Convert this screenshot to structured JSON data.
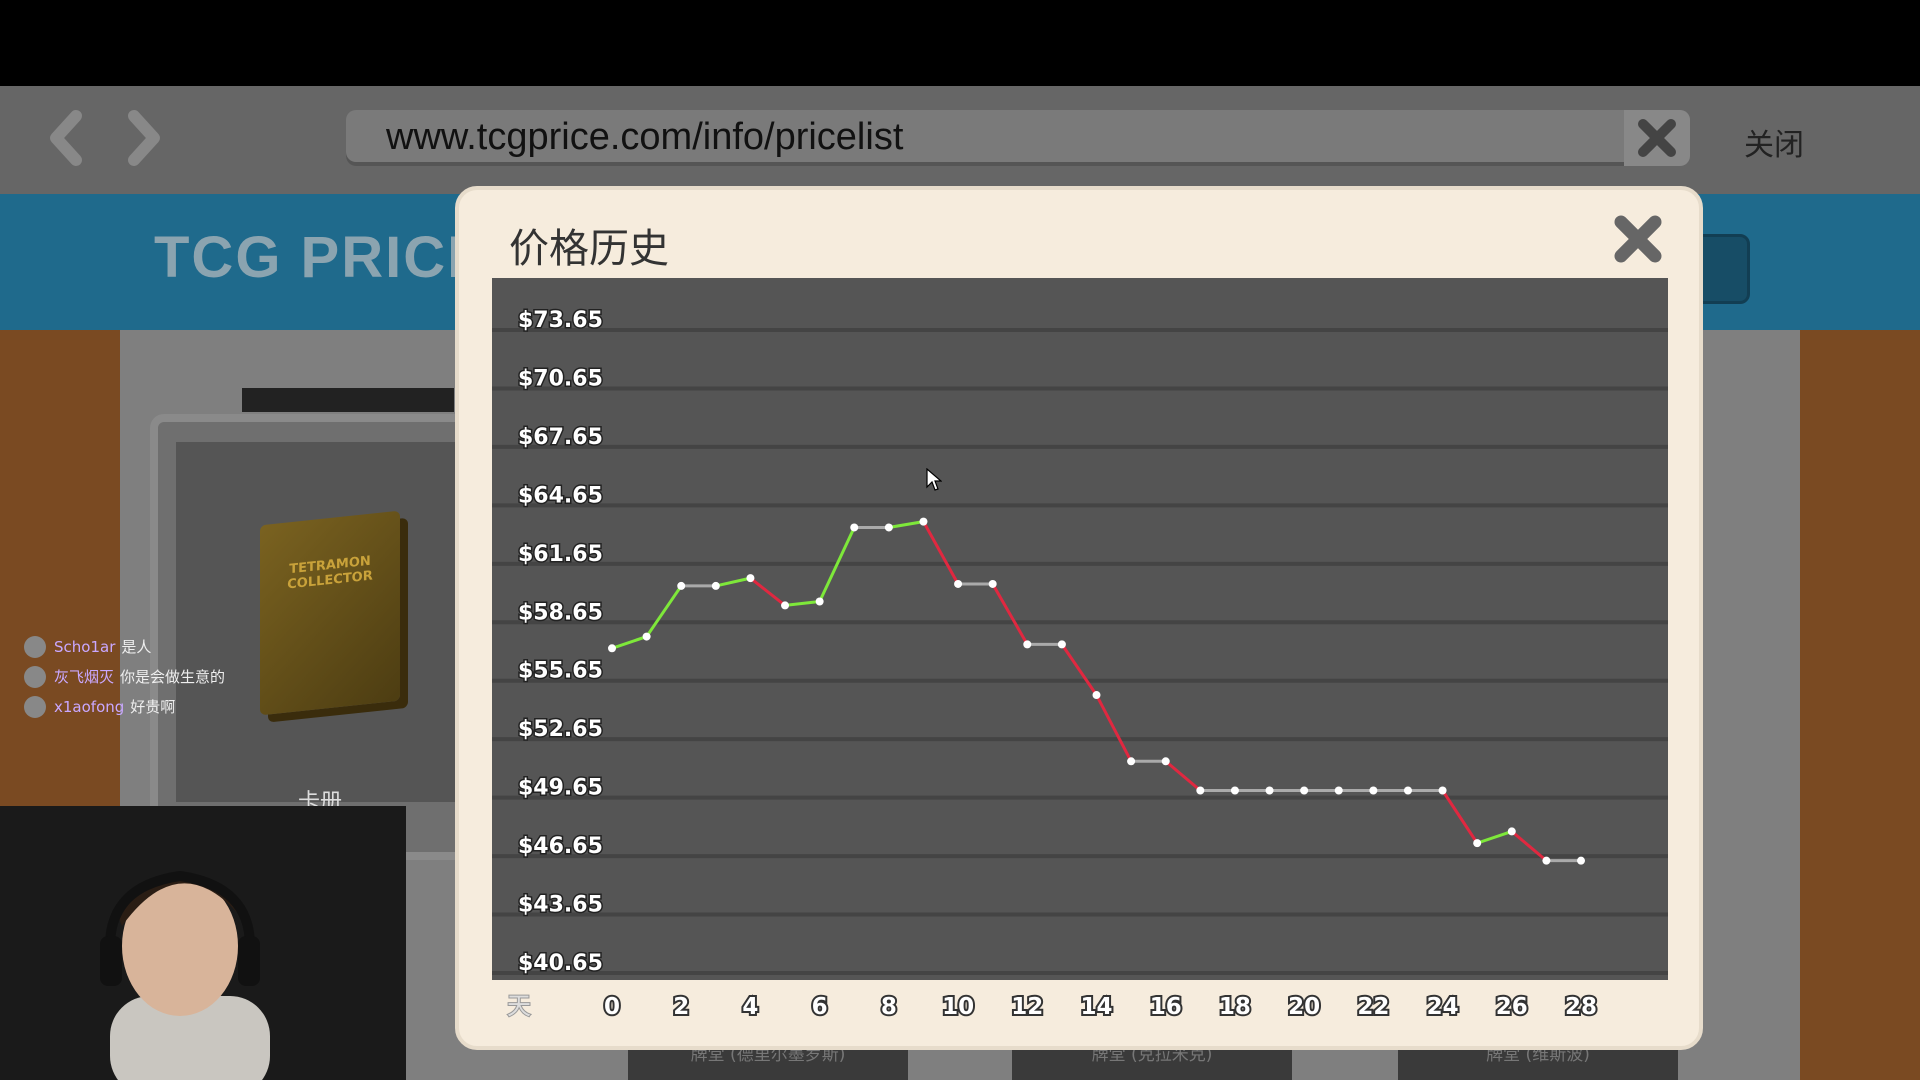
{
  "browser": {
    "url": "www.tcgprice.com/info/pricelist",
    "close_label": "关闭"
  },
  "site": {
    "logo_text": "TCG PRICE"
  },
  "card_panel": {
    "binder_text": "TETRAMON COLLECTOR",
    "label": "卡册"
  },
  "bottom_tabs": [
    "牌堂 (德里尔墨罗斯)",
    "牌堂 (克拉米克)",
    "牌堂 (维斯波)"
  ],
  "chat": [
    {
      "user": "Scho1ar",
      "message": "是人"
    },
    {
      "user": "灰飞烟灭",
      "message": "你是会做生意的"
    },
    {
      "user": "x1aofong",
      "message": "好贵啊"
    }
  ],
  "webcam_text": "册",
  "modal": {
    "title": "价格历史",
    "x_unit_label": "天"
  },
  "colors": {
    "up": "#7ee83a",
    "down": "#e02840",
    "flat": "#aaaaaa",
    "point": "#ffffff"
  },
  "chart_data": {
    "type": "line",
    "title": "价格历史",
    "xlabel": "天",
    "ylabel": "",
    "y_ticks": [
      "$73.65",
      "$70.65",
      "$67.65",
      "$64.65",
      "$61.65",
      "$58.65",
      "$55.65",
      "$52.65",
      "$49.65",
      "$46.65",
      "$43.65",
      "$40.65"
    ],
    "x_ticks": [
      "0",
      "2",
      "4",
      "6",
      "8",
      "10",
      "12",
      "14",
      "16",
      "18",
      "20",
      "22",
      "24",
      "26",
      "28"
    ],
    "ylim": [
      40.65,
      73.65
    ],
    "xlim": [
      0,
      28
    ],
    "grid": true,
    "x": [
      0,
      1,
      2,
      3,
      4,
      5,
      6,
      7,
      8,
      9,
      10,
      11,
      12,
      13,
      14,
      15,
      16,
      17,
      18,
      19,
      20,
      21,
      22,
      23,
      24,
      25,
      26,
      27,
      28
    ],
    "values": [
      56.7,
      57.3,
      59.9,
      59.9,
      60.3,
      58.9,
      59.1,
      62.9,
      62.9,
      63.2,
      60.0,
      60.0,
      56.9,
      56.9,
      54.3,
      50.9,
      50.9,
      49.4,
      49.4,
      49.4,
      49.4,
      49.4,
      49.4,
      49.4,
      49.4,
      46.7,
      47.3,
      45.8,
      45.8
    ]
  }
}
